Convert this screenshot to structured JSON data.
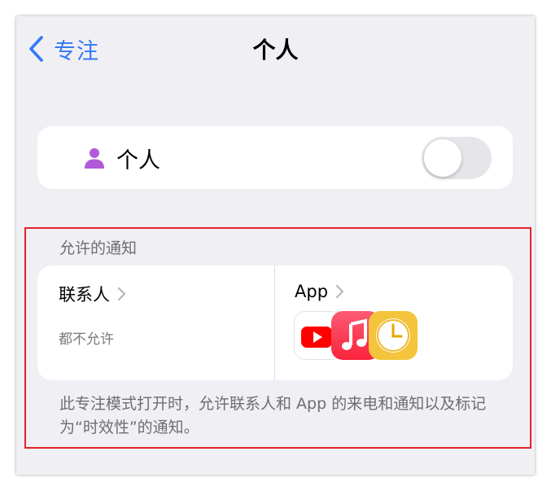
{
  "nav": {
    "back_label": "专注",
    "title": "个人"
  },
  "focus_toggle": {
    "label": "个人",
    "enabled": false,
    "icon": "person-icon",
    "icon_color": "#b15ad9"
  },
  "allowed_notifications": {
    "header": "允许的通知",
    "contacts": {
      "title": "联系人",
      "subtitle": "都不允许"
    },
    "apps": {
      "title": "App",
      "icons": [
        "youtube-icon",
        "music-icon",
        "clock-icon"
      ]
    },
    "footer": "此专注模式打开时，允许联系人和 App 的来电和通知以及标记为“时效性”的通知。"
  },
  "colors": {
    "accent": "#3478f6",
    "highlight_border": "#e5232b",
    "background": "#f0eff4"
  }
}
